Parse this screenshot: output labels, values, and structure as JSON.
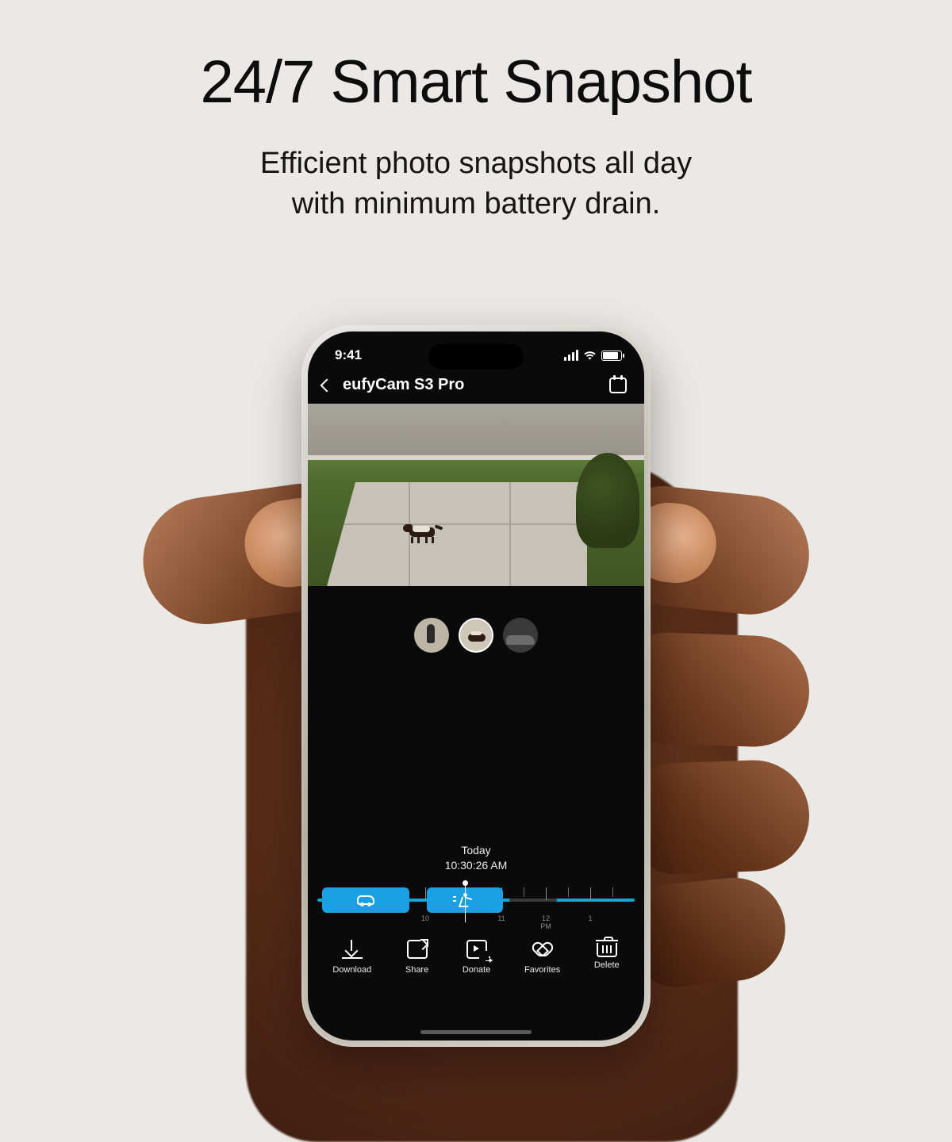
{
  "marketing": {
    "headline": "24/7 Smart Snapshot",
    "subhead_line1": "Efficient photo snapshots all day",
    "subhead_line2": "with minimum battery drain."
  },
  "statusbar": {
    "time": "9:41"
  },
  "nav": {
    "title": "eufyCam S3 Pro"
  },
  "thumbnails": [
    {
      "id": "person",
      "selected": false
    },
    {
      "id": "pet",
      "selected": true
    },
    {
      "id": "vehicle",
      "selected": false
    }
  ],
  "timestamp": {
    "day": "Today",
    "time": "10:30:26 AM"
  },
  "timeline": {
    "ticks": [
      "10",
      "11",
      "12",
      "1"
    ],
    "pm_label": "PM",
    "events": [
      {
        "type": "vehicle"
      },
      {
        "type": "person"
      }
    ]
  },
  "actions": {
    "download": "Download",
    "share": "Share",
    "donate": "Donate",
    "favorites": "Favorites",
    "delete": "Delete"
  }
}
